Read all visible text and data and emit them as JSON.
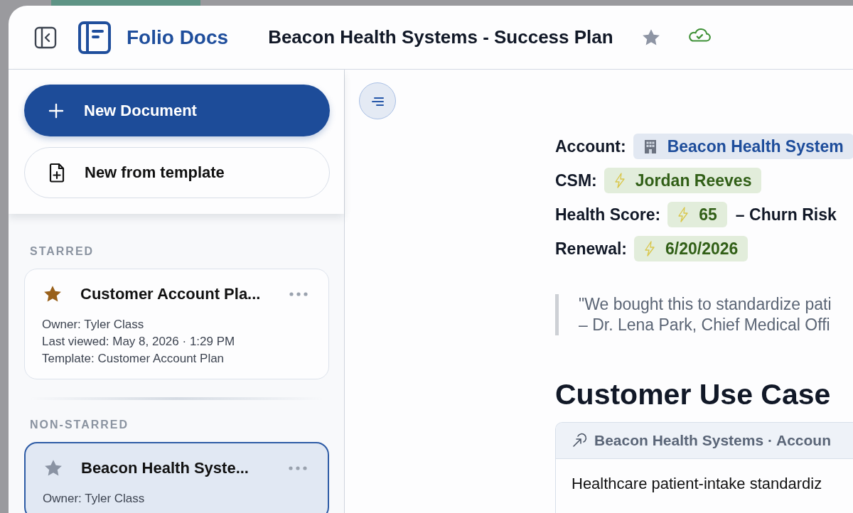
{
  "app": {
    "name": "Folio Docs"
  },
  "header": {
    "document_title": "Beacon Health Systems - Success Plan",
    "starred": false,
    "synced": true
  },
  "sidebar": {
    "primary_button": "New Document",
    "template_button": "New from template",
    "sections": [
      {
        "heading": "STARRED",
        "documents": [
          {
            "title": "Customer Account Pla...",
            "starred": true,
            "selected": false,
            "meta": [
              "Owner: Tyler Class",
              "Last viewed: May 8, 2026 · 1:29 PM",
              "Template: Customer Account Plan"
            ]
          }
        ]
      },
      {
        "heading": "NON-STARRED",
        "documents": [
          {
            "title": "Beacon Health Syste...",
            "starred": false,
            "selected": true,
            "meta": [
              "Owner: Tyler Class"
            ]
          }
        ]
      }
    ]
  },
  "document": {
    "fields": [
      {
        "label": "Account:",
        "value": "Beacon Health System",
        "kind": "account"
      },
      {
        "label": "CSM:",
        "value": "Jordan Reeves",
        "kind": "synced"
      },
      {
        "label": "Health Score:",
        "value": "65",
        "kind": "synced",
        "suffix": "– Churn Risk"
      },
      {
        "label": "Renewal:",
        "value": "6/20/2026",
        "kind": "synced"
      }
    ],
    "quote": [
      "\"We bought this to standardize pati",
      "– Dr. Lena Park, Chief Medical Offi"
    ],
    "heading": "Customer Use Case",
    "embed": {
      "title": "Beacon Health Systems · Accoun",
      "body": "Healthcare patient-intake standardiz"
    }
  }
}
